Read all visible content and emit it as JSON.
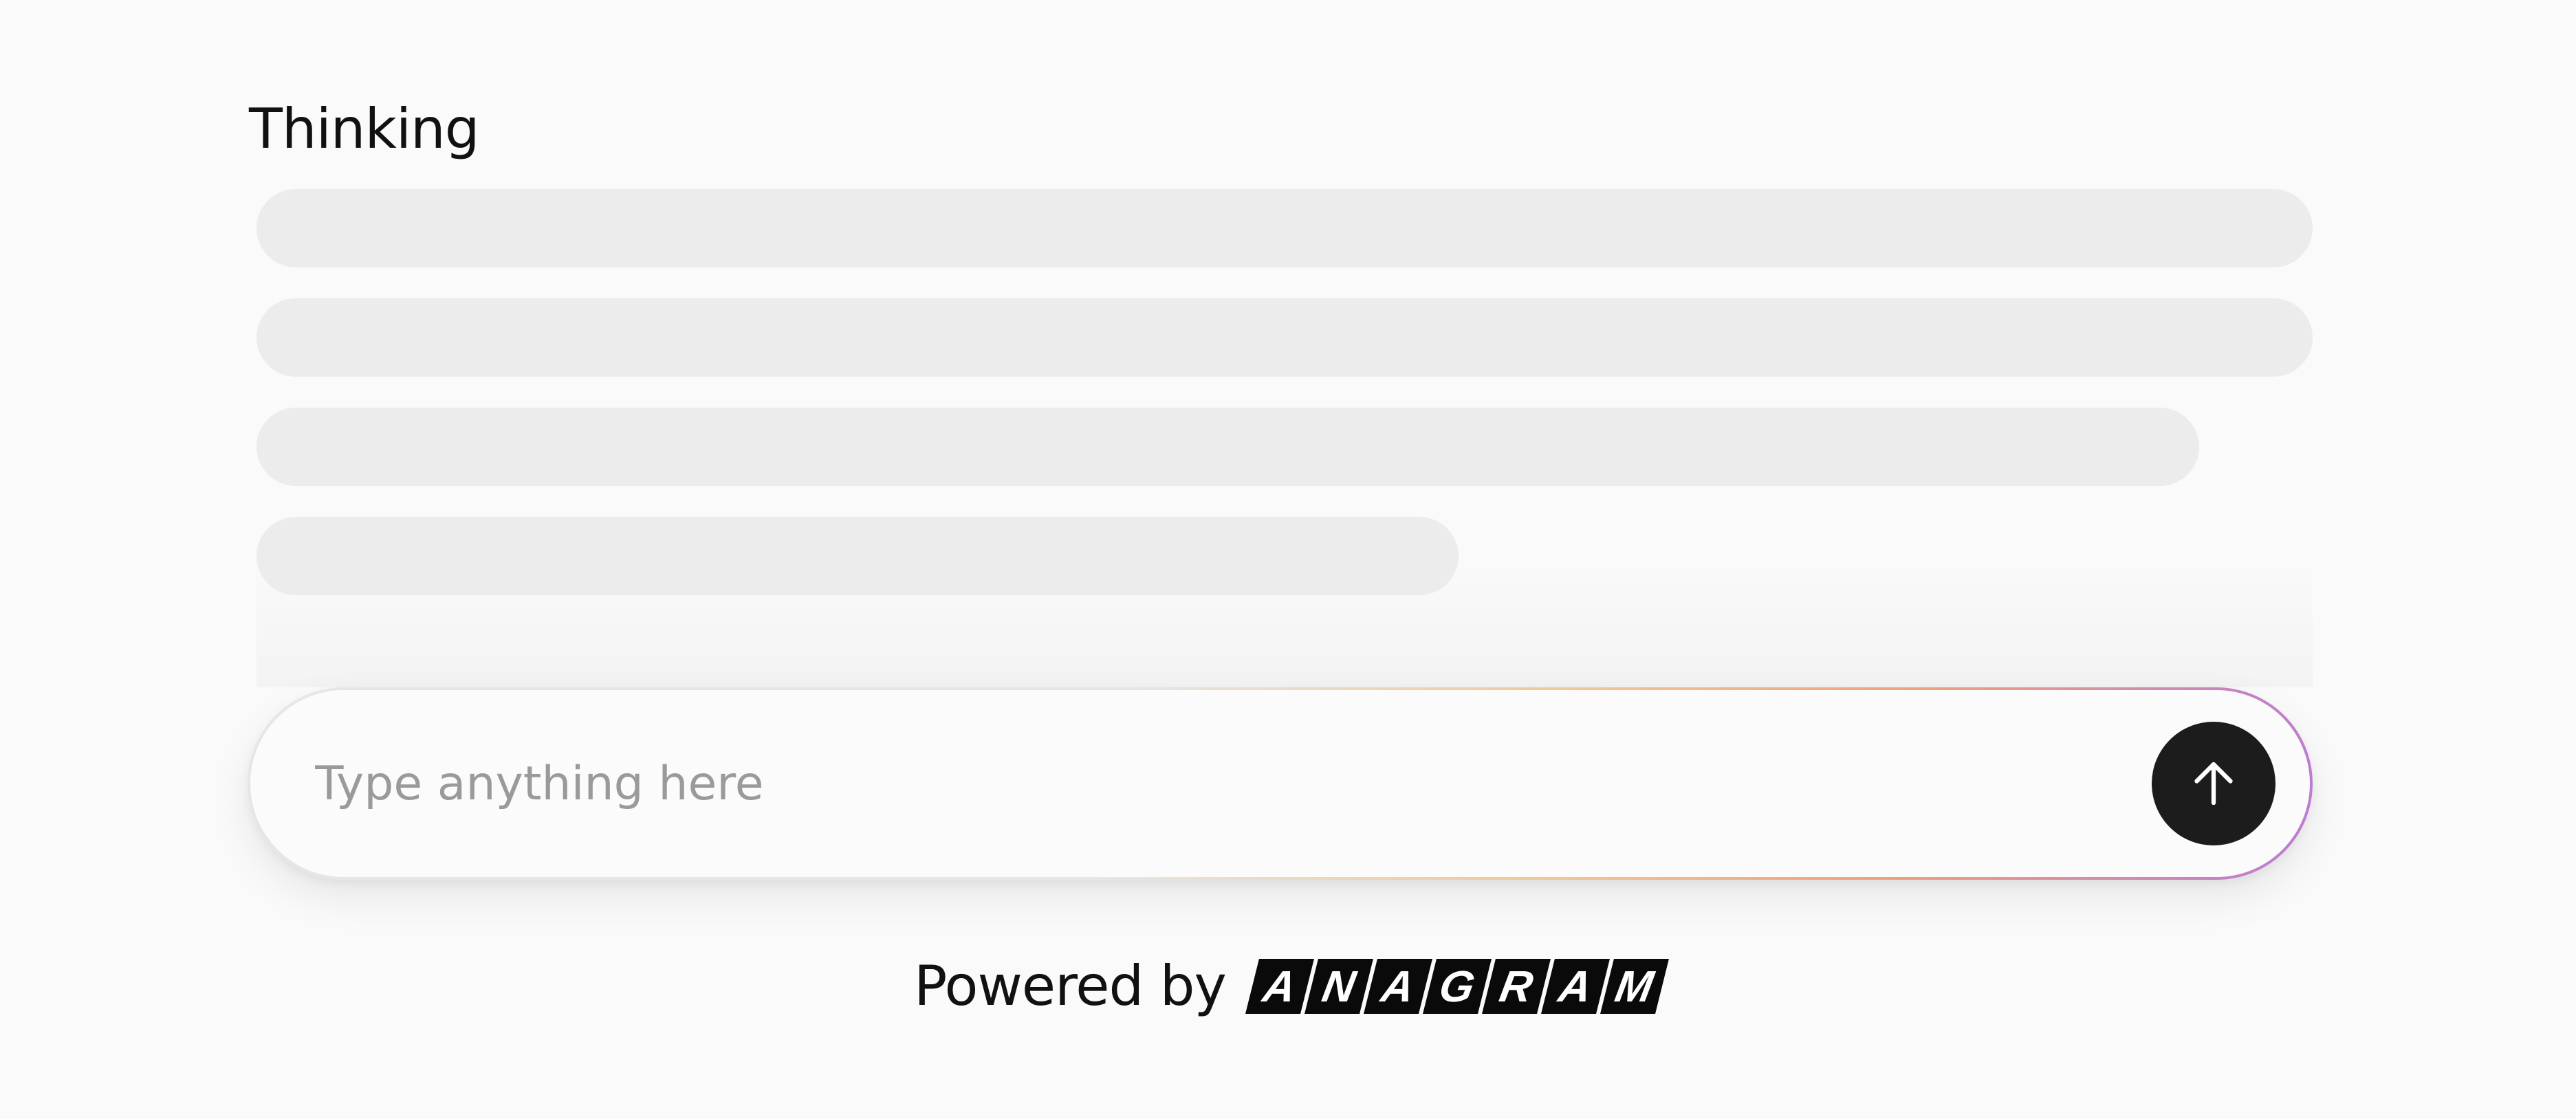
{
  "status": {
    "label": "Thinking"
  },
  "loading_skeleton": {
    "line_count": 4
  },
  "composer": {
    "placeholder": "Type anything here",
    "value": "",
    "send_icon": "arrow-up-icon"
  },
  "footer": {
    "powered_label": "Powered by",
    "brand_letters": [
      "A",
      "N",
      "A",
      "G",
      "R",
      "A",
      "M"
    ]
  },
  "colors": {
    "background": "#fafafa",
    "skeleton": "#ececec",
    "send_button": "#1c1c1c",
    "border_gradient": [
      "#e6e6e6",
      "#f1c99a",
      "#f0a07c",
      "#b97ad6"
    ]
  }
}
